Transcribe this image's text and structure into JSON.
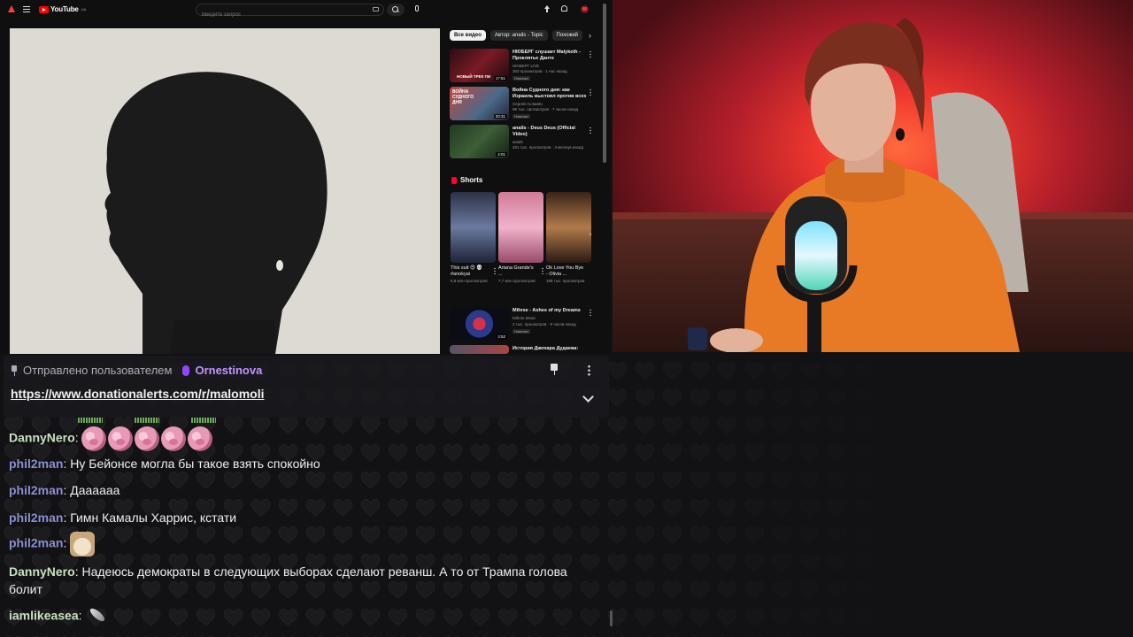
{
  "youtube": {
    "logo_text": "YouTube",
    "logo_region": "UA",
    "search_placeholder": "Введите запрос",
    "chips": [
      "Все видео",
      "Автор: anails - Topic",
      "Похожий"
    ],
    "recommendations": [
      {
        "title": "НЮБЕРГ слушает Malyketh - Проклятье Данте",
        "channel": "НЮБЕРГ LIVE",
        "meta": "303 просмотров · 1 час назад",
        "tag": "Новинка",
        "duration": "17:51",
        "thumb_caption": "НОВЫЙ ТРЕК ПИ"
      },
      {
        "title": "Война Судного дня: как Израиль выстоял против всех",
        "channel": "Сергей Асланян",
        "meta": "96 тыс. просмотров · 7 часов назад",
        "tag": "Новинка",
        "duration": "20:31",
        "thumb_caption": "ВОЙНА СУДНОГО ДНЯ"
      },
      {
        "title": "anails - Deus Deus (Official Video)",
        "channel": "anails",
        "meta": "201 тыс. просмотров · 3 месяца назад",
        "tag": "",
        "duration": "4:01",
        "thumb_caption": ""
      }
    ],
    "shorts_title": "Shorts",
    "shorts": [
      {
        "title": "This suit 😍 💀 #anokyai",
        "views": "5,8 млн просмотров"
      },
      {
        "title": "Ariana Grande's ...",
        "views": "7,7 млн просмотров"
      },
      {
        "title": "Ok Love You Bye - Olivia ...",
        "views": "185 тыс. просмотров"
      }
    ],
    "bottom_recos": [
      {
        "title": "Mihrse - Ashes of my Dreams",
        "channel": "Mihrse Music",
        "meta": "2 тыс. просмотров · 9 часов назад",
        "tag": "Новинка",
        "duration": "3:52"
      },
      {
        "title": "История Джохара Дудаева:",
        "channel": "",
        "meta": "",
        "tag": "",
        "duration": ""
      }
    ]
  },
  "pinned": {
    "label": "Отправлено пользователем",
    "user": "Ornestinova",
    "link": "https://www.donationalerts.com/r/malomoli"
  },
  "chat": {
    "messages": [
      {
        "user": "DannyNero",
        "text": ""
      },
      {
        "user": "phil2man",
        "text": "Ну Бейонсе могла бы такое взять спокойно"
      },
      {
        "user": "phil2man",
        "text": "Дааааaa"
      },
      {
        "user": "phil2man",
        "text": "Гимн Камалы Харрис, кстати"
      },
      {
        "user": "phil2man",
        "text": ""
      },
      {
        "user": "DannyNero",
        "text": "Надеюсь демократы в следующих выборах сделают реванш. А то от Трампа голова болит"
      },
      {
        "user": "iamlikeasea",
        "text": ""
      }
    ],
    "separator": ": "
  },
  "colors": {
    "twitch_purple": "#9147ff",
    "user_green": "#c9e0c2",
    "user_blue": "#8a8fd0",
    "youtube_red": "#ff0000"
  },
  "icons": {
    "pin": "pin-icon",
    "more": "vertical-dots-icon",
    "expand": "chevron-down-icon",
    "search": "search-icon",
    "mic": "mic-icon",
    "upload": "upload-icon",
    "bell": "bell-icon"
  }
}
